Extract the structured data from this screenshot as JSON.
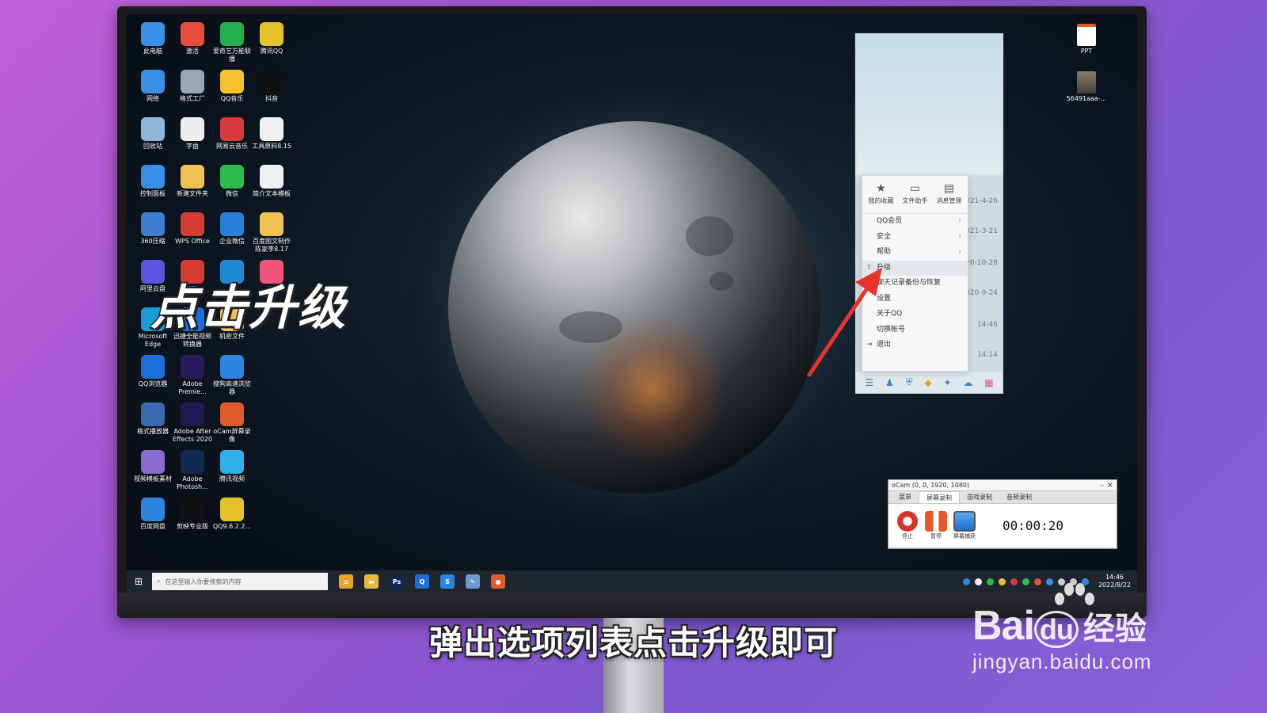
{
  "desktop": {
    "icons": [
      {
        "label": "此电脑",
        "color": "#3a8ee6"
      },
      {
        "label": "激活",
        "color": "#e84c3d"
      },
      {
        "label": "爱奇艺万能联播",
        "color": "#22b14c"
      },
      {
        "label": "腾讯QQ",
        "color": "#e6c229"
      },
      {
        "label": "网络",
        "color": "#3a8ee6"
      },
      {
        "label": "格式工厂",
        "color": "#9aa8b5"
      },
      {
        "label": "QQ音乐",
        "color": "#f3c12b"
      },
      {
        "label": "抖音",
        "color": "#111111"
      },
      {
        "label": "回收站",
        "color": "#8fb8d8"
      },
      {
        "label": "字由",
        "color": "#eeeeee"
      },
      {
        "label": "网易云音乐",
        "color": "#d73a3a"
      },
      {
        "label": "工具原料8.15",
        "color": "#f0f0f0"
      },
      {
        "label": "控制面板",
        "color": "#3a8ee6"
      },
      {
        "label": "新建文件夹",
        "color": "#f0c050"
      },
      {
        "label": "微信",
        "color": "#2dbd4f"
      },
      {
        "label": "简介文本模板",
        "color": "#f0f0f0"
      },
      {
        "label": "360压缩",
        "color": "#3a7fd0"
      },
      {
        "label": "WPS Office",
        "color": "#d43c33"
      },
      {
        "label": "企业微信",
        "color": "#2a7ed8"
      },
      {
        "label": "百度图文制作陈家李8.17",
        "color": "#f0c050"
      },
      {
        "label": "阿里云盘",
        "color": "#5a54e0"
      },
      {
        "label": "W",
        "color": "#d43c33"
      },
      {
        "label": "",
        "color": "#1e8ad6"
      },
      {
        "label": "",
        "color": "#f0567a"
      },
      {
        "label": "Microsoft Edge",
        "color": "#1a9ad6"
      },
      {
        "label": "迅捷全能视频转换器",
        "color": "#1b6ee0"
      },
      {
        "label": "机密文件",
        "color": "#f0c050"
      },
      {
        "label": "",
        "color": "transparent"
      },
      {
        "label": "QQ浏览器",
        "color": "#1e6fd9"
      },
      {
        "label": "Adobe Premie...",
        "color": "#2a1a5e"
      },
      {
        "label": "搜狗高速浏览器",
        "color": "#2a86e0"
      },
      {
        "label": "",
        "color": "transparent"
      },
      {
        "label": "格式播放器",
        "color": "#3a6ab0"
      },
      {
        "label": "Adobe After Effects 2020",
        "color": "#1f1a4f"
      },
      {
        "label": "oCam屏幕录像",
        "color": "#e05a2a"
      },
      {
        "label": "",
        "color": "transparent"
      },
      {
        "label": "视频模板素材",
        "color": "#8a6ad0"
      },
      {
        "label": "Adobe Photosh...",
        "color": "#0e2a50"
      },
      {
        "label": "腾讯视频",
        "color": "#2fb0e8"
      },
      {
        "label": "",
        "color": "transparent"
      },
      {
        "label": "百度网盘",
        "color": "#2a86e0"
      },
      {
        "label": "剪映专业版",
        "color": "#111111"
      },
      {
        "label": "QQ9.6.2.2...",
        "color": "#e6c229"
      }
    ],
    "right_icons": [
      {
        "label": "PPT",
        "color": "#e05a2a"
      },
      {
        "label": "56491aaa-...",
        "color": "#6a6a6a"
      }
    ]
  },
  "overlay_caption": "点击升级",
  "qq_panel": {
    "dates": [
      "2021-4-26",
      "2021-3-21",
      "2020-10-28",
      "2020-9-24",
      "14:46",
      "14:14"
    ],
    "bottom_icons": [
      "menu-icon",
      "contacts-icon",
      "app-icon",
      "game-icon",
      "puzzle-icon",
      "cloud-icon",
      "grid-icon"
    ]
  },
  "context_menu": {
    "top_items": [
      {
        "label": "我的收藏",
        "glyph": "★"
      },
      {
        "label": "文件助手",
        "glyph": "▭"
      },
      {
        "label": "消息管理",
        "glyph": "▤"
      }
    ],
    "items": [
      {
        "label": "QQ会员",
        "has_arrow": true
      },
      {
        "label": "安全",
        "has_arrow": true
      },
      {
        "label": "帮助",
        "has_arrow": true
      },
      {
        "label": "升级",
        "has_arrow": false,
        "active": true
      },
      {
        "label": "聊天记录备份与恢复",
        "has_arrow": false
      },
      {
        "label": "设置",
        "has_arrow": false
      },
      {
        "label": "关于QQ",
        "has_arrow": false
      },
      {
        "label": "切换帐号",
        "has_arrow": false
      },
      {
        "label": "退出",
        "has_arrow": false
      }
    ]
  },
  "ocam": {
    "title": "oCam (0, 0, 1920, 1080)",
    "tabs": [
      "菜单",
      "屏幕录制",
      "游戏录制",
      "音频录制"
    ],
    "active_tab": 1,
    "buttons": [
      {
        "label": "停止",
        "color": "#d8332b"
      },
      {
        "label": "暂停",
        "color": "#e8562a"
      },
      {
        "label": "屏幕捕获",
        "color": "#2a7ed8"
      }
    ],
    "timer": "00:00:20"
  },
  "taskbar": {
    "search_placeholder": "在这里输入你要搜索的内容",
    "apps": [
      {
        "name": "store",
        "glyph": "⌂",
        "color": "#e8a32a"
      },
      {
        "name": "explorer",
        "glyph": "▬",
        "color": "#e8b840"
      },
      {
        "name": "photoshop",
        "glyph": "Ps",
        "color": "#0e2a50"
      },
      {
        "name": "qq-browser",
        "glyph": "Q",
        "color": "#1e6fd9"
      },
      {
        "name": "sogou-browser",
        "glyph": "S",
        "color": "#2a86e0"
      },
      {
        "name": "notes",
        "glyph": "✎",
        "color": "#6a9ad0"
      },
      {
        "name": "ocam",
        "glyph": "●",
        "color": "#e05a2a"
      }
    ],
    "clock_time": "14:46",
    "clock_date": "2022/8/22"
  },
  "subtitle": "弹出选项列表点击升级即可",
  "watermark": {
    "brand_a": "Bai",
    "brand_b": "du",
    "brand_cn": "经验",
    "url": "jingyan.baidu.com"
  }
}
